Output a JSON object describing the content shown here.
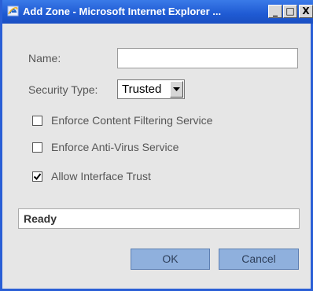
{
  "window": {
    "title": "Add Zone - Microsoft Internet Explorer ...",
    "minimize_label": "_",
    "maximize_label": "□",
    "close_label": "X"
  },
  "form": {
    "name_label": "Name:",
    "name_value": "",
    "security_type_label": "Security Type:",
    "security_type_value": "Trusted",
    "checkboxes": [
      {
        "label": "Enforce Content Filtering Service",
        "checked": false
      },
      {
        "label": "Enforce Anti-Virus Service",
        "checked": false
      },
      {
        "label": "Allow Interface Trust",
        "checked": true
      }
    ]
  },
  "status": {
    "text": "Ready"
  },
  "buttons": {
    "ok_label": "OK",
    "cancel_label": "Cancel"
  },
  "colors": {
    "titlebar": "#1f5ad3",
    "button_bg": "#8fb0dd",
    "window_bg": "#e6e6e6"
  },
  "icons": {
    "title_icon": "ie-logo-icon",
    "dropdown": "chevron-down-icon",
    "check": "check-icon"
  }
}
